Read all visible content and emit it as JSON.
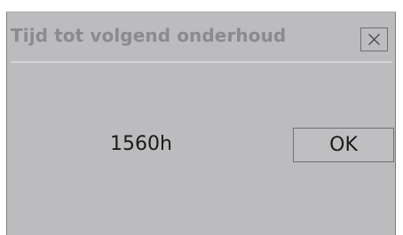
{
  "dialog": {
    "title": "Tijd tot volgend onderhoud",
    "close_icon": "close-icon",
    "hours_value": "1560h",
    "ok_label": "OK"
  },
  "colors": {
    "dialog_background": "#bcbcbe",
    "title_text": "#8b8b8e",
    "separator": "#d6d6d8",
    "body_text": "#1a1a1a",
    "button_border": "#6f6f72"
  }
}
